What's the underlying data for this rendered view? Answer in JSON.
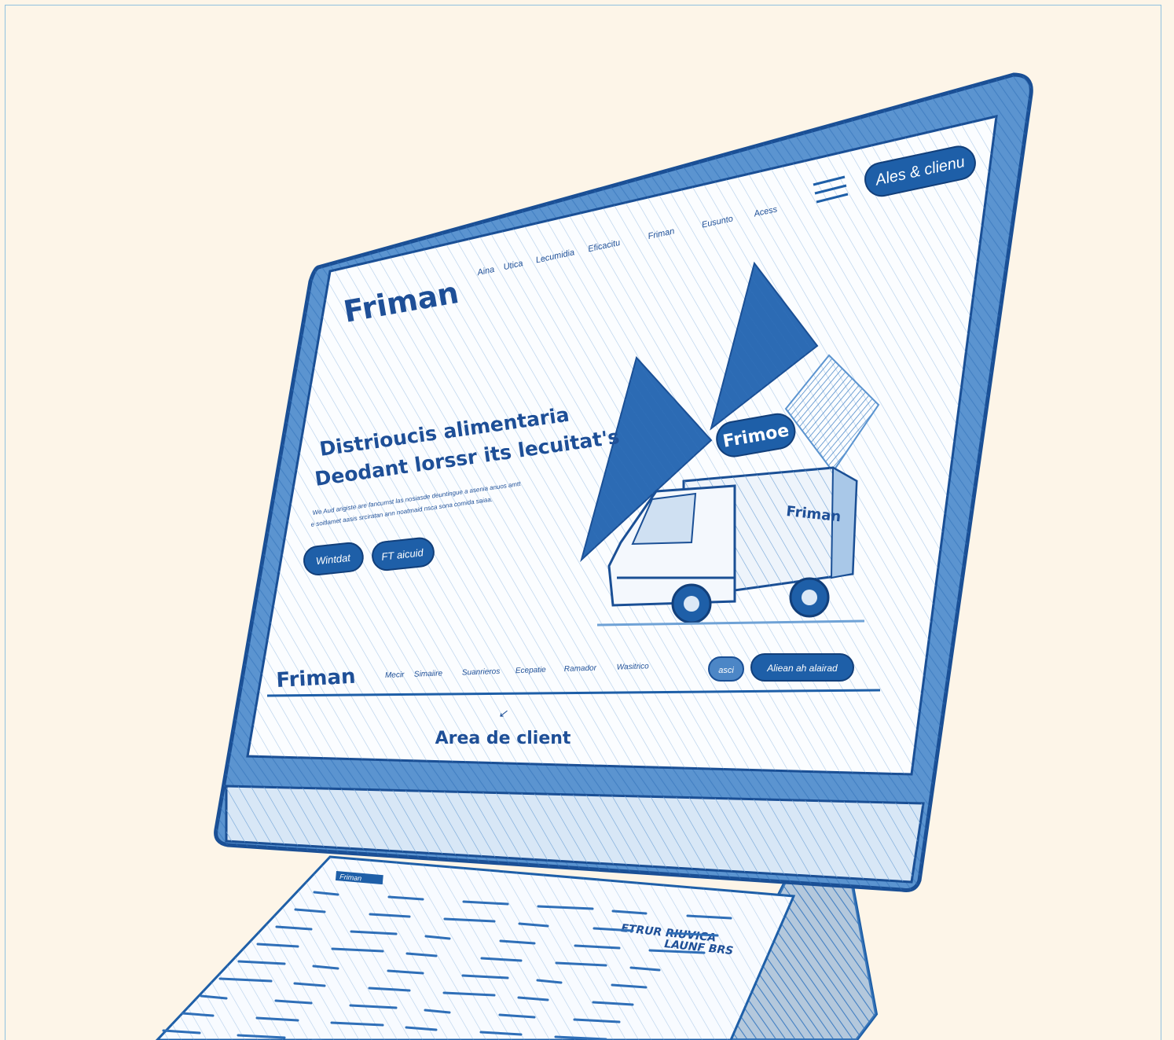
{
  "header": {
    "logo": "Friman",
    "nav_items": [
      "Aina",
      "Utica",
      "Lecumidia",
      "Eficacitu",
      "Friman",
      "Eusunto",
      "Acess"
    ],
    "cta_label": "Ales & clienu"
  },
  "hero": {
    "title_line1": "Distrioucis alimentaria",
    "title_line2": "Deodant lorssr its lecuitat's",
    "body_line1": "We Aud arigiste are fancumst las nosiasde deuntingue a asenia anuos amtt",
    "body_line2": "e soitlamet aasis srciratan ann noatmaid nsca sona comida saiaa.",
    "button1_label": "Wintdat",
    "button2_label": "FT aicuid",
    "badge_label": "Frimoe",
    "truck_label": "Friman"
  },
  "footer_bar": {
    "logo": "Friman",
    "nav_items": [
      "Mecir",
      "Simaiire",
      "Suanrieros",
      "Ecepatie",
      "Ramador",
      "Wasitrico"
    ],
    "icon_button_label": "asci",
    "cta_label": "Aliean ah alairad"
  },
  "client_area": {
    "title": "Area de client"
  },
  "document": {
    "header_label": "Friman",
    "summary_line1": "ETRUR RIUVICA",
    "summary_line2": "LAUNF BRS"
  },
  "colors": {
    "ink": "#1e5fa8",
    "paper": "#fdf5e8",
    "accent": "#1f4f99"
  }
}
